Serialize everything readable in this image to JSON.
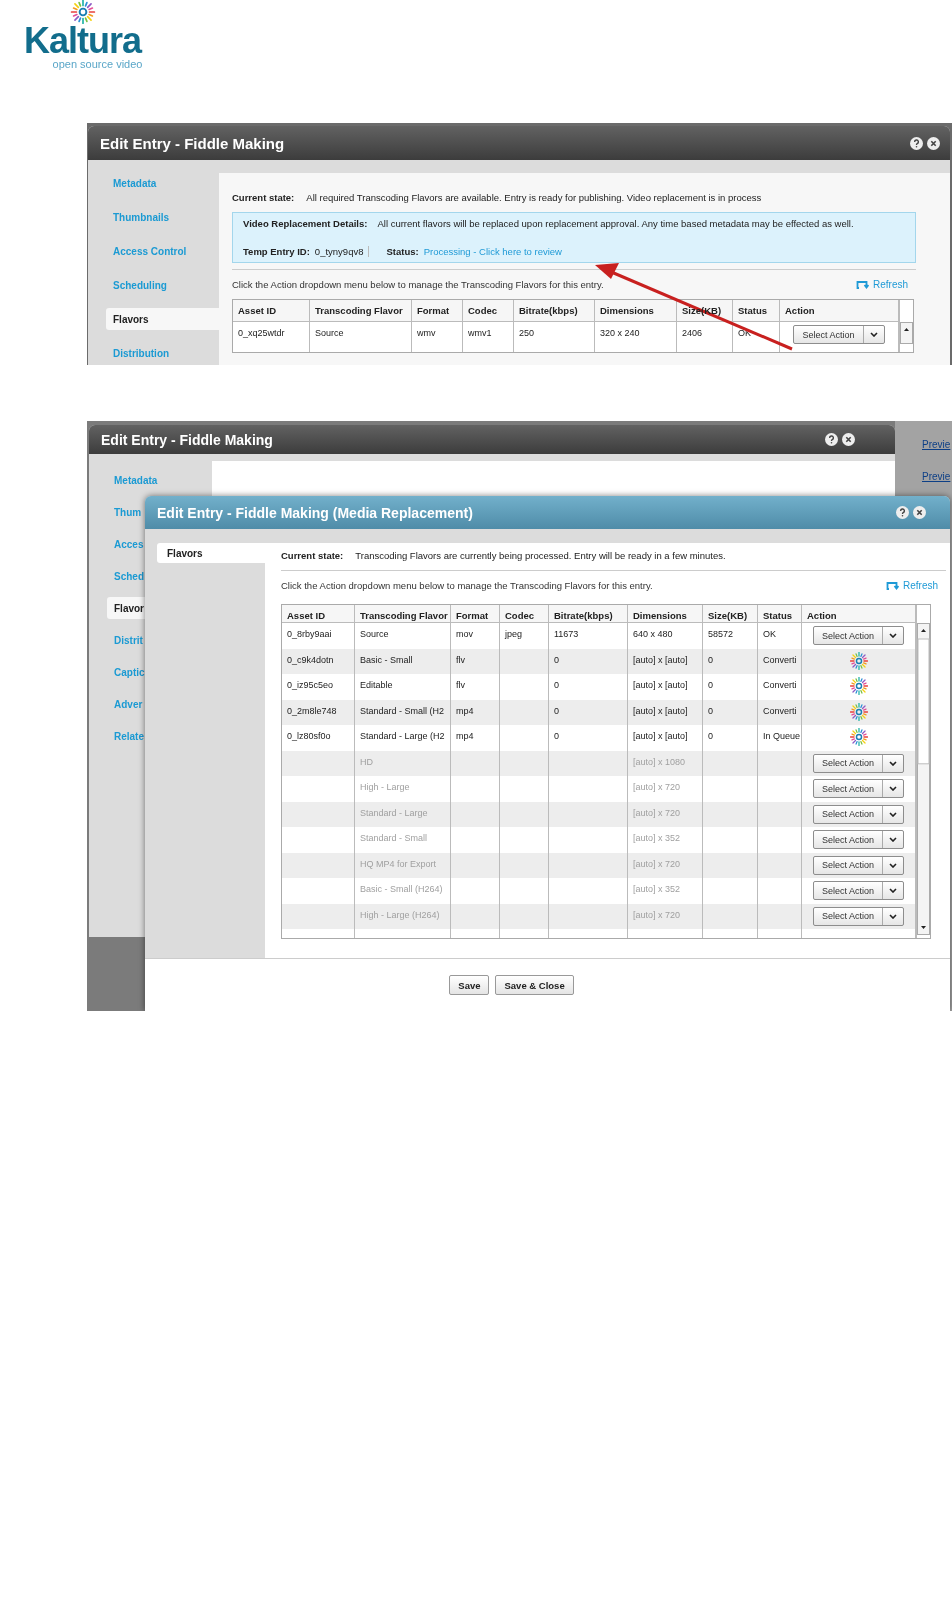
{
  "logo": {
    "name": "Kaltura",
    "tagline": "open source video"
  },
  "screenshot_1": {
    "window": {
      "title": "Edit Entry - Fiddle Making"
    },
    "sidebar": [
      {
        "label": "Metadata",
        "selected": false
      },
      {
        "label": "Thumbnails",
        "selected": false
      },
      {
        "label": "Access Control",
        "selected": false
      },
      {
        "label": "Scheduling",
        "selected": false
      },
      {
        "label": "Flavors",
        "selected": true
      },
      {
        "label": "Distribution",
        "selected": false
      }
    ],
    "current_state": {
      "label": "Current state:",
      "text": "All required Transcoding Flavors are available. Entry is ready for publishing. Video replacement is in process"
    },
    "replacement_details": {
      "label": "Video Replacement Details:",
      "text": "All current flavors will be replaced upon replacement approval. Any time based metadata may be effected as well.",
      "temp_entry_label": "Temp Entry ID:",
      "temp_entry_id": "0_tyny9qv8",
      "status_label": "Status:",
      "status_link": "Processing - Click here to review"
    },
    "instructions": "Click the Action dropdown menu below to manage the Transcoding Flavors for this entry.",
    "refresh": "Refresh",
    "table": {
      "columns": [
        "Asset ID",
        "Transcoding Flavor",
        "Format",
        "Codec",
        "Bitrate(kbps)",
        "Dimensions",
        "Size(KB)",
        "Status",
        "Action"
      ],
      "rows": [
        {
          "disabled": false,
          "asset_id": "0_xq25wtdr",
          "flavor": "Source",
          "format": "wmv",
          "codec": "wmv1",
          "bitrate": "250",
          "dimensions": "320 x 240",
          "size": "2406",
          "status": "OK",
          "action": {
            "kind": "menu",
            "label": "Select Action"
          }
        }
      ]
    }
  },
  "screenshot_2": {
    "background_window": {
      "title": "Edit Entry - Fiddle Making",
      "sidebar": [
        {
          "label": "Metadata",
          "selected": false
        },
        {
          "label": "Thum",
          "selected": false
        },
        {
          "label": "Acces",
          "selected": false
        },
        {
          "label": "Sched",
          "selected": false
        },
        {
          "label": "Flavor",
          "selected": true
        },
        {
          "label": "Distrit",
          "selected": false
        },
        {
          "label": "Captic",
          "selected": false
        },
        {
          "label": "Adver",
          "selected": false
        },
        {
          "label": "Relate",
          "selected": false
        }
      ]
    },
    "side_links": [
      "Previe",
      "Previe"
    ],
    "dialog": {
      "title": "Edit Entry - Fiddle Making (Media Replacement)",
      "tabs": [
        {
          "label": "Flavors",
          "selected": true
        }
      ],
      "current_state": {
        "label": "Current state:",
        "text": "Transcoding Flavors are currently being processed. Entry will be ready in a few minutes."
      },
      "instructions": "Click the Action dropdown menu below to manage the Transcoding Flavors for this entry.",
      "refresh": "Refresh",
      "table": {
        "columns": [
          "Asset ID",
          "Transcoding Flavor",
          "Format",
          "Codec",
          "Bitrate(kbps)",
          "Dimensions",
          "Size(KB)",
          "Status",
          "Action"
        ],
        "rows": [
          {
            "disabled": false,
            "asset_id": "0_8rby9aai",
            "flavor": "Source",
            "format": "mov",
            "codec": "jpeg",
            "bitrate": "11673",
            "dimensions": "640 x 480",
            "size": "58572",
            "status": "OK",
            "action": {
              "kind": "menu",
              "label": "Select Action"
            }
          },
          {
            "disabled": false,
            "asset_id": "0_c9k4dotn",
            "flavor": "Basic - Small",
            "format": "flv",
            "bitrate": "0",
            "dimensions": "[auto] x [auto]",
            "size": "0",
            "status": "Converti",
            "action": {
              "kind": "spinner"
            }
          },
          {
            "disabled": false,
            "asset_id": "0_iz95c5eo",
            "flavor": "Editable",
            "format": "flv",
            "bitrate": "0",
            "dimensions": "[auto] x [auto]",
            "size": "0",
            "status": "Converti",
            "action": {
              "kind": "spinner"
            }
          },
          {
            "disabled": false,
            "asset_id": "0_2m8le748",
            "flavor": "Standard - Small (H2",
            "format": "mp4",
            "bitrate": "0",
            "dimensions": "[auto] x [auto]",
            "size": "0",
            "status": "Converti",
            "action": {
              "kind": "spinner"
            }
          },
          {
            "disabled": false,
            "asset_id": "0_lz80sf0o",
            "flavor": "Standard - Large (H2",
            "format": "mp4",
            "bitrate": "0",
            "dimensions": "[auto] x [auto]",
            "size": "0",
            "status": "In Queue",
            "action": {
              "kind": "spinner"
            }
          },
          {
            "disabled": true,
            "flavor": "HD",
            "dimensions": "[auto] x 1080",
            "action": {
              "kind": "menu",
              "label": "Select Action"
            }
          },
          {
            "disabled": true,
            "flavor": "High - Large",
            "dimensions": "[auto] x 720",
            "action": {
              "kind": "menu",
              "label": "Select Action"
            }
          },
          {
            "disabled": true,
            "flavor": "Standard - Large",
            "dimensions": "[auto] x 720",
            "action": {
              "kind": "menu",
              "label": "Select Action"
            }
          },
          {
            "disabled": true,
            "flavor": "Standard - Small",
            "dimensions": "[auto] x 352",
            "action": {
              "kind": "menu",
              "label": "Select Action"
            }
          },
          {
            "disabled": true,
            "flavor": "HQ MP4 for Export",
            "dimensions": "[auto] x 720",
            "action": {
              "kind": "menu",
              "label": "Select Action"
            }
          },
          {
            "disabled": true,
            "flavor": "Basic - Small (H264)",
            "dimensions": "[auto] x 352",
            "action": {
              "kind": "menu",
              "label": "Select Action"
            }
          },
          {
            "disabled": true,
            "flavor": "High - Large (H264)",
            "dimensions": "[auto] x 720",
            "action": {
              "kind": "menu",
              "label": "Select Action"
            }
          }
        ]
      },
      "buttons": [
        "Save",
        "Save & Close"
      ]
    }
  }
}
